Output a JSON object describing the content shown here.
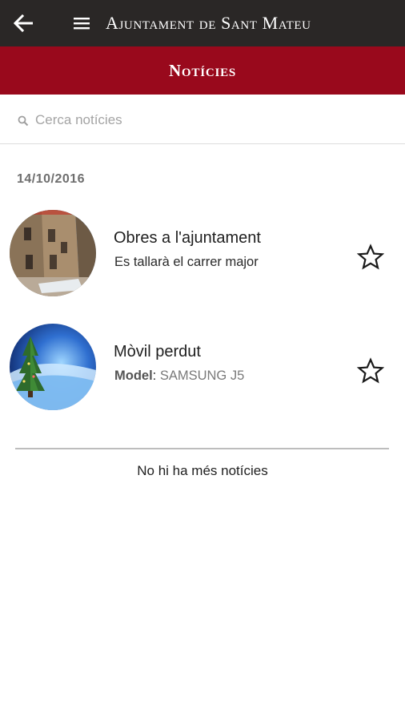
{
  "header": {
    "app_title": "Ajuntament de Sant Mateu",
    "back_icon": "arrow-back-icon",
    "menu_icon": "hamburger-menu-icon",
    "background_color": "#2a2726"
  },
  "section": {
    "title": "Notícies",
    "background_color": "#99091c"
  },
  "search": {
    "placeholder": "Cerca notícies",
    "value": "",
    "icon": "search-icon"
  },
  "news": {
    "date": "14/10/2016",
    "items": [
      {
        "title": "Obres a l'ajuntament",
        "subtitle": "Es tallarà el carrer major",
        "image": "town-hall-street-photo",
        "favorite": false
      },
      {
        "title": "Mòvil perdut",
        "subtitle_key": "Model",
        "subtitle_sep": ": ",
        "subtitle_value": "SAMSUNG J5",
        "image": "christmas-tree-wallpaper",
        "favorite": false
      }
    ],
    "end_message": "No hi ha més notícies"
  }
}
